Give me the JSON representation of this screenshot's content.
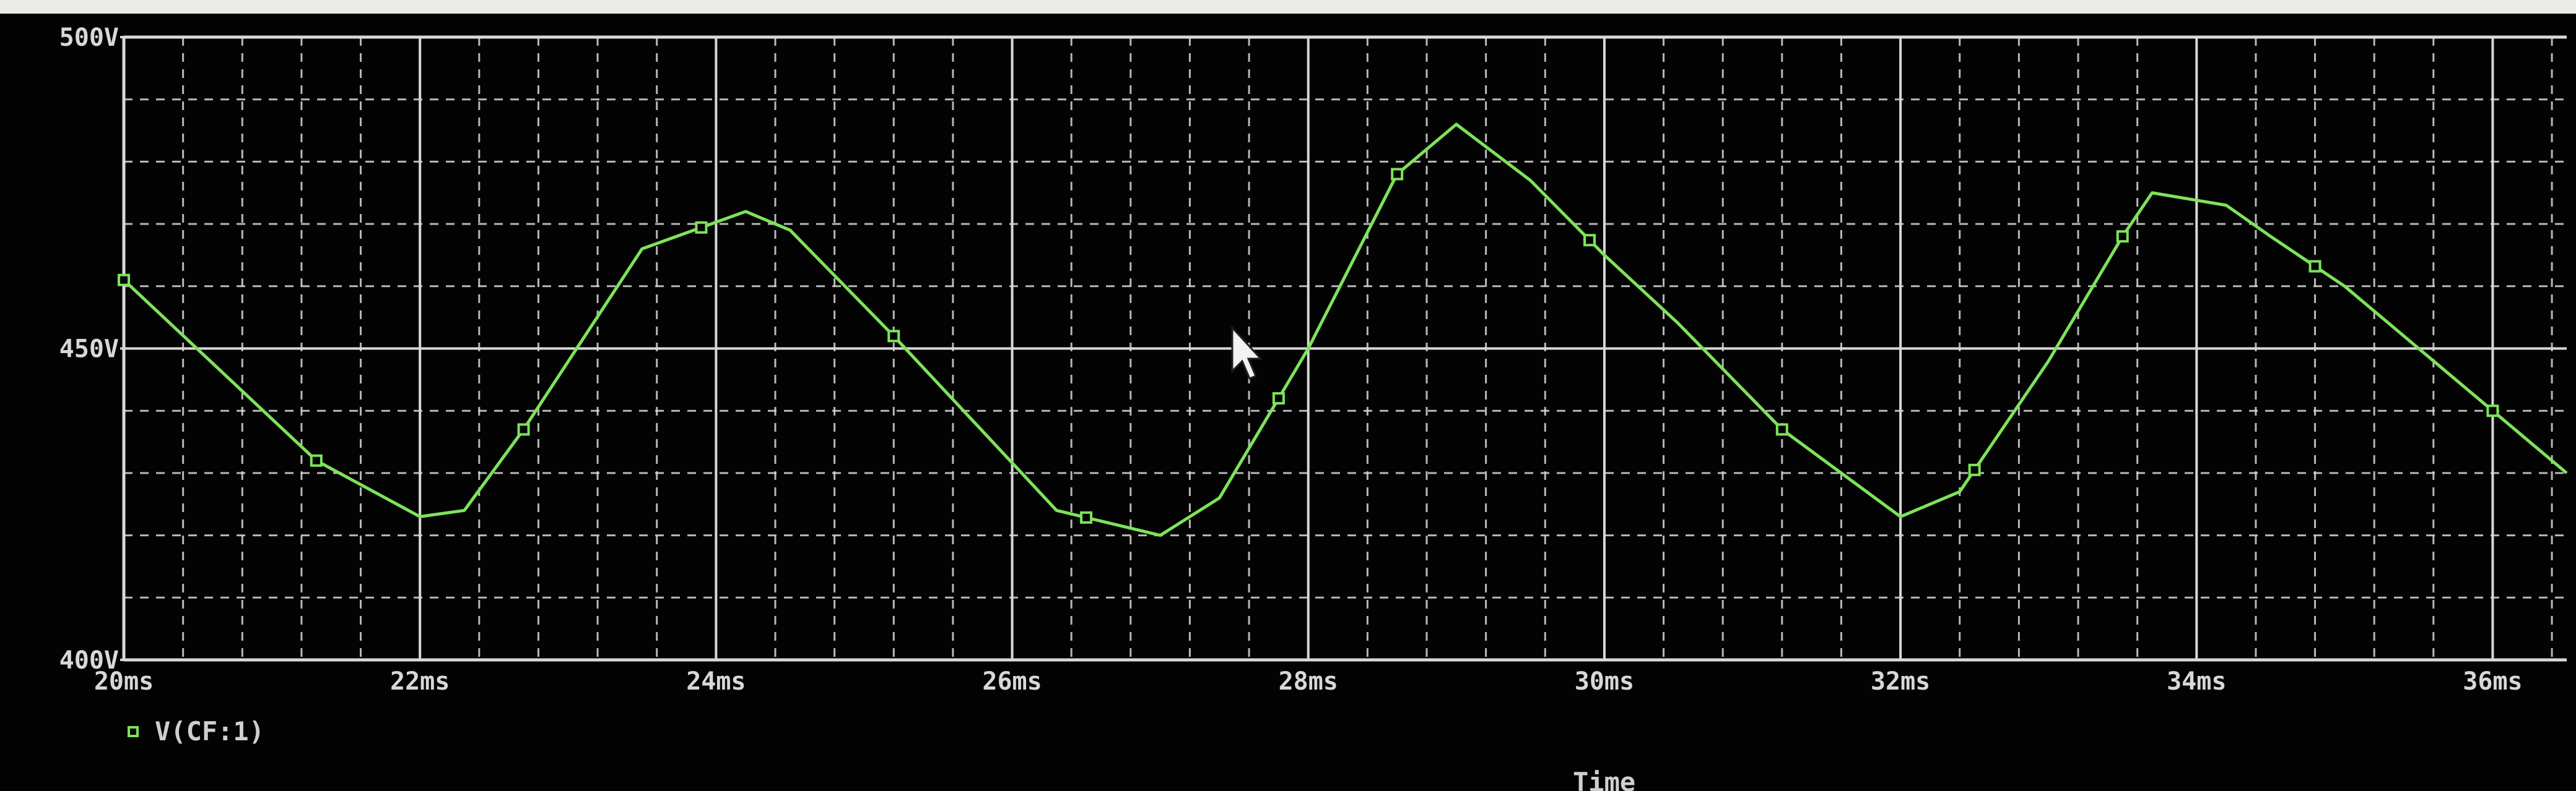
{
  "colors": {
    "background": "#030303",
    "grid": "#d8d8d8",
    "trace": "#7ee35a",
    "text": "#d8d8d8"
  },
  "chart_data": {
    "type": "line",
    "xlabel": "Time",
    "ylabel": "",
    "x_unit": "ms",
    "y_unit": "V",
    "xlim": [
      20,
      36.5
    ],
    "ylim": [
      400,
      500
    ],
    "x_ticks": [
      "20ms",
      "22ms",
      "24ms",
      "26ms",
      "28ms",
      "30ms",
      "32ms",
      "34ms",
      "36ms"
    ],
    "y_ticks": [
      "400V",
      "450V",
      "500V"
    ],
    "grid": true,
    "legend": "bottom-left",
    "series": [
      {
        "name": "V(CF:1)",
        "marker": "square",
        "x": [
          20.0,
          21.3,
          22.0,
          22.3,
          22.7,
          23.5,
          24.2,
          24.5,
          25.2,
          26.3,
          27.0,
          27.4,
          28.0,
          28.6,
          29.0,
          29.5,
          30.0,
          30.5,
          31.2,
          32.0,
          32.4,
          33.0,
          33.5,
          33.7,
          34.2,
          34.5,
          35.0,
          35.5,
          36.0,
          36.5
        ],
        "y": [
          461,
          432,
          423,
          424,
          437,
          466,
          472,
          469,
          452,
          424,
          420,
          426,
          450,
          478,
          486,
          477,
          465,
          454,
          437,
          423,
          427,
          448,
          468,
          475,
          473,
          468,
          460,
          450,
          440,
          430
        ]
      }
    ],
    "marker_x": [
      20.0,
      21.3,
      22.7,
      23.9,
      25.2,
      26.5,
      27.8,
      28.6,
      29.9,
      31.2,
      32.5,
      33.5,
      34.8,
      36.0
    ]
  }
}
